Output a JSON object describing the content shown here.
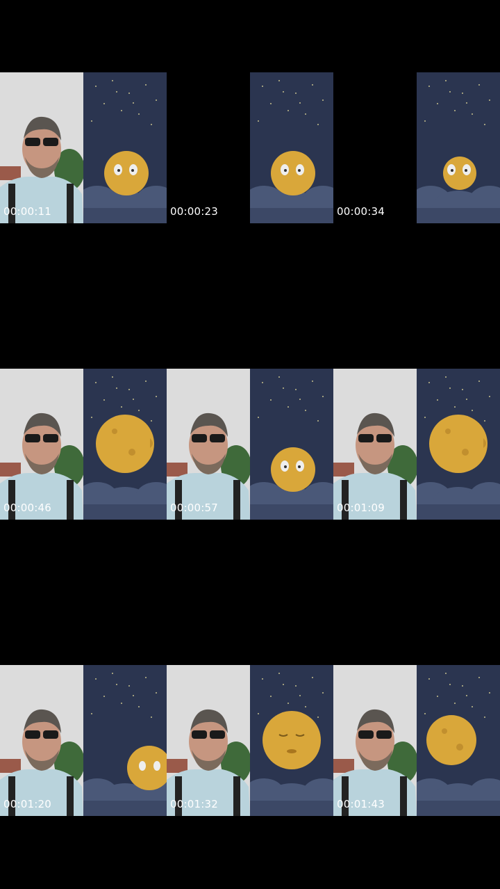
{
  "frames": [
    {
      "timestamp": "00:00:11",
      "selfie": true,
      "moon": "front"
    },
    {
      "timestamp": "00:00:23",
      "selfie": false,
      "moon": "front"
    },
    {
      "timestamp": "00:00:34",
      "selfie": false,
      "moon": "front-small"
    },
    {
      "timestamp": "00:00:46",
      "selfie": true,
      "moon": "profile"
    },
    {
      "timestamp": "00:00:57",
      "selfie": true,
      "moon": "front"
    },
    {
      "timestamp": "00:01:09",
      "selfie": true,
      "moon": "profile"
    },
    {
      "timestamp": "00:01:20",
      "selfie": true,
      "moon": "edge"
    },
    {
      "timestamp": "00:01:32",
      "selfie": true,
      "moon": "sleeping"
    },
    {
      "timestamp": "00:01:43",
      "selfie": true,
      "moon": "plain"
    }
  ],
  "colors": {
    "sky": "#2b3550",
    "cloud": "#4a5878",
    "moon": "#d9a73a",
    "selfie_sky": "#dcdcdc",
    "shirt": "#b9d3dc"
  }
}
